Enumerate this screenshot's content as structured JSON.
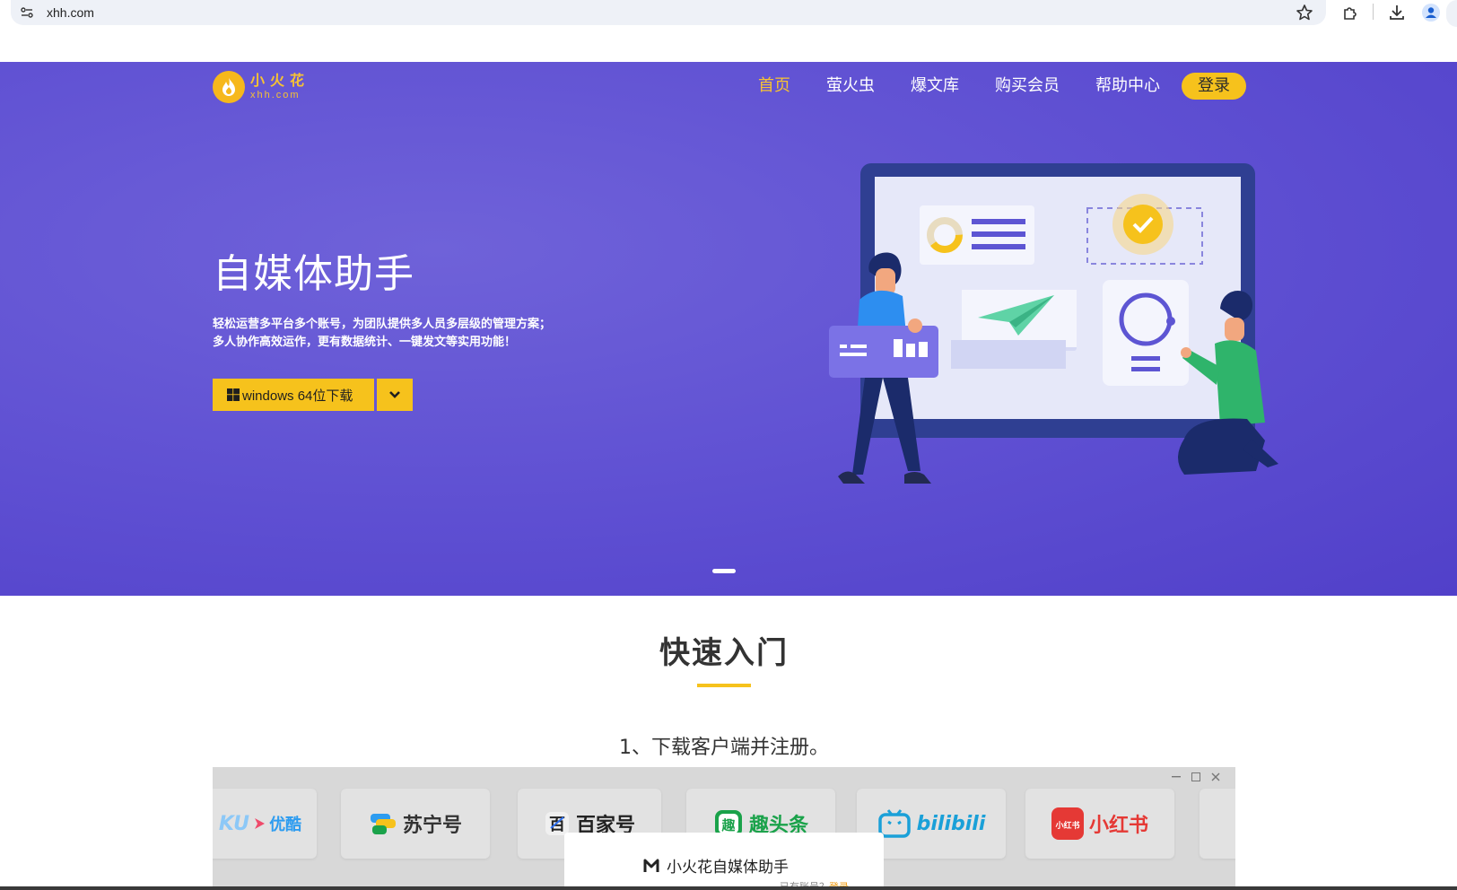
{
  "browser": {
    "url": "xhh.com"
  },
  "brand": {
    "name_cn": "小火花",
    "name_en": "xhh.com",
    "accent": "#f6c21c",
    "hero_bg": "#5e4fd2"
  },
  "nav": {
    "items": [
      {
        "label": "首页",
        "active": true
      },
      {
        "label": "萤火虫",
        "active": false
      },
      {
        "label": "爆文库",
        "active": false
      },
      {
        "label": "购买会员",
        "active": false
      },
      {
        "label": "帮助中心",
        "active": false
      }
    ],
    "login": "登录"
  },
  "hero": {
    "title": "自媒体助手",
    "desc_line1": "轻松运营多平台多个账号，为团队提供多人员多层级的管理方案；",
    "desc_line2": "多人协作高效运作，更有数据统计、一键发文等实用功能！",
    "download_label": "windows 64位下载"
  },
  "quickstart": {
    "title": "快速入门",
    "step1": "1、下载客户端并注册。"
  },
  "preview": {
    "platforms": [
      {
        "label": "优酷",
        "prefix": "KU",
        "color": "#2d9cf0"
      },
      {
        "label": "苏宁号",
        "color": "#333333"
      },
      {
        "label": "百家号",
        "color": "#222222"
      },
      {
        "label": "趣头条",
        "color": "#1aa24a"
      },
      {
        "label": "bilibili",
        "color": "#1aa0d8"
      },
      {
        "label": "小红书",
        "color": "#e53935"
      }
    ],
    "dialog_title": "小火花自媒体助手",
    "dialog_sub": "已有账号？",
    "dialog_link": "登录"
  }
}
